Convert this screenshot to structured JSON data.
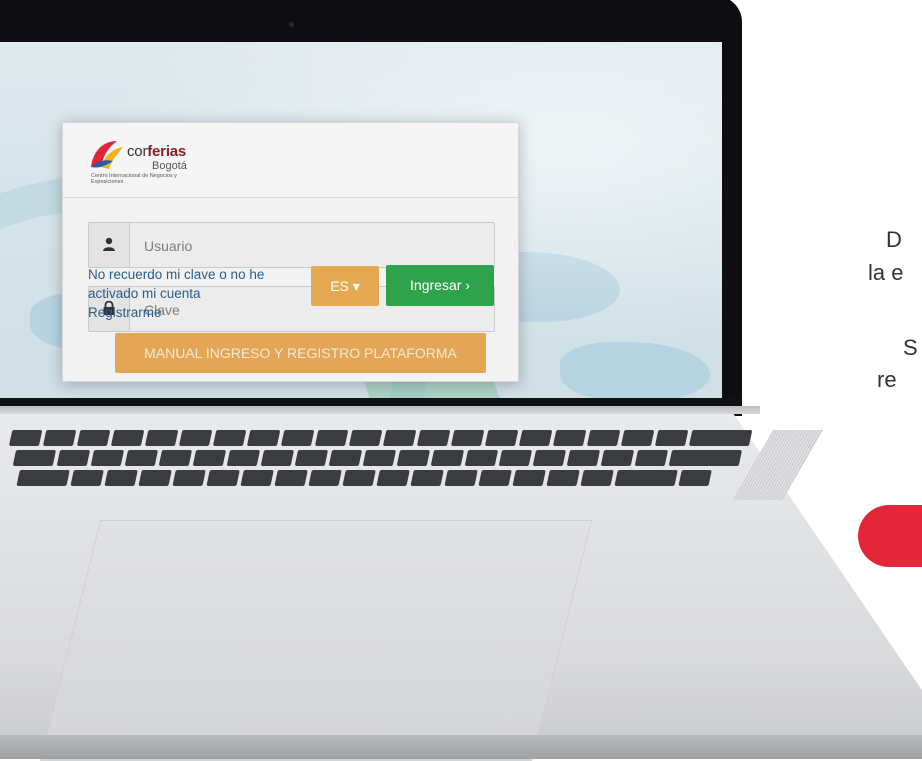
{
  "login": {
    "logo": {
      "brand_prefix": "cor",
      "brand_suffix": "ferias",
      "city": "Bogotá",
      "tagline": "Centro Internacional de Negocios y Exposiciones"
    },
    "username_placeholder": "Usuario",
    "password_placeholder": "Clave",
    "links": {
      "forgot_line1": "No recuerdo mi clave o no he",
      "forgot_line2": "activado mi cuenta",
      "register": "Registrarme"
    },
    "language_button": "ES ▾",
    "login_button": "Ingresar  ›",
    "manual_button": "MANUAL INGRESO Y REGISTRO PLATAFORMA"
  },
  "side": {
    "line1": "D",
    "line2": "la e",
    "line3": "S",
    "line4": "re"
  },
  "colors": {
    "link": "#2b5d8a",
    "login_green": "#2fa24c",
    "lang_orange": "#e6a953",
    "manual_orange": "#e2a656",
    "side_red": "#e3253a"
  }
}
